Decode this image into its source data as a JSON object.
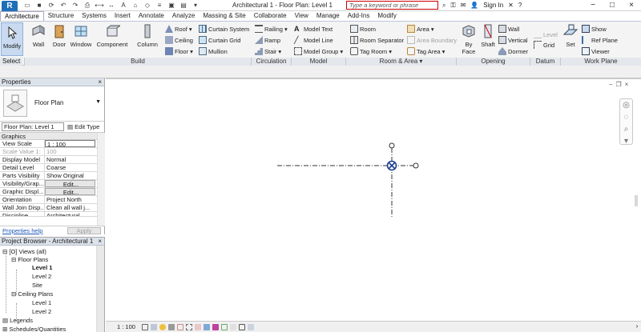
{
  "titlebar": {
    "logo": "R",
    "document_title": "Architectural 1 - Floor Plan: Level 1",
    "search_placeholder": "Type a keyword or phrase",
    "sign_in": "Sign In",
    "minimize": "−",
    "maximize": "□",
    "close": "×"
  },
  "tabs": [
    {
      "label": "Architecture",
      "active": true
    },
    {
      "label": "Structure"
    },
    {
      "label": "Systems"
    },
    {
      "label": "Insert"
    },
    {
      "label": "Annotate"
    },
    {
      "label": "Analyze"
    },
    {
      "label": "Massing & Site"
    },
    {
      "label": "Collaborate"
    },
    {
      "label": "View"
    },
    {
      "label": "Manage"
    },
    {
      "label": "Add-Ins"
    },
    {
      "label": "Modify"
    }
  ],
  "ribbon": {
    "select": {
      "modify": "Modify",
      "label": "Select ▾"
    },
    "build": {
      "label": "Build",
      "wall": "Wall",
      "door": "Door",
      "window": "Window",
      "component": "Component",
      "column": "Column",
      "roof": "Roof",
      "ceiling": "Ceiling",
      "floor": "Floor",
      "curtain_system": "Curtain System",
      "curtain_grid": "Curtain Grid",
      "mullion": "Mullion"
    },
    "circulation": {
      "label": "Circulation",
      "railing": "Railing",
      "ramp": "Ramp",
      "stair": "Stair"
    },
    "model": {
      "label": "Model",
      "model_text": "Model Text",
      "model_line": "Model Line",
      "model_group": "Model Group"
    },
    "room_area": {
      "label": "Room & Area ▾",
      "room": "Room",
      "room_separator": "Room Separator",
      "tag_room": "Tag Room",
      "area": "Area",
      "area_boundary": "Area Boundary",
      "tag_area": "Tag Area"
    },
    "opening": {
      "label": "Opening",
      "by_face": "By Face",
      "shaft": "Shaft",
      "wall": "Wall",
      "vertical": "Vertical",
      "dormer": "Dormer"
    },
    "datum": {
      "label": "Datum",
      "level": "Level",
      "grid": "Grid"
    },
    "work_plane": {
      "label": "Work Plane",
      "set": "Set",
      "show": "Show",
      "ref_plane": "Ref Plane",
      "viewer": "Viewer"
    }
  },
  "properties": {
    "title": "Properties",
    "close": "×",
    "type_name": "Floor Plan",
    "instance": "Floor Plan: Level 1",
    "edit_type": "Edit Type",
    "section": "Graphics",
    "rows": [
      {
        "key": "View Scale",
        "value": "1 : 100"
      },
      {
        "key": "Scale Value   1:",
        "value": "100"
      },
      {
        "key": "Display Model",
        "value": "Normal"
      },
      {
        "key": "Detail Level",
        "value": "Coarse"
      },
      {
        "key": "Parts Visibility",
        "value": "Show Original"
      },
      {
        "key": "Visibility/Grap...",
        "value": "Edit..."
      },
      {
        "key": "Graphic Displ...",
        "value": "Edit..."
      },
      {
        "key": "Orientation",
        "value": "Project North"
      },
      {
        "key": "Wall Join Disp...",
        "value": "Clean all wall j..."
      },
      {
        "key": "Discipline",
        "value": "Architectural"
      }
    ],
    "help": "Properties help",
    "apply": "Apply"
  },
  "browser": {
    "title": "Project Browser - Architectural 1",
    "close": "×",
    "views_all": "Views (all)",
    "floor_plans": "Floor Plans",
    "fp_level1": "Level 1",
    "fp_level2": "Level 2",
    "fp_site": "Site",
    "ceiling_plans": "Ceiling Plans",
    "cp_level1": "Level 1",
    "cp_level2": "Level 2",
    "legends": "Legends",
    "schedules": "Schedules/Quantities"
  },
  "viewbar": {
    "scale": "1 : 100"
  },
  "colors": {
    "accent": "#1f6fb8",
    "canvas_marker": "#1c3f94"
  }
}
